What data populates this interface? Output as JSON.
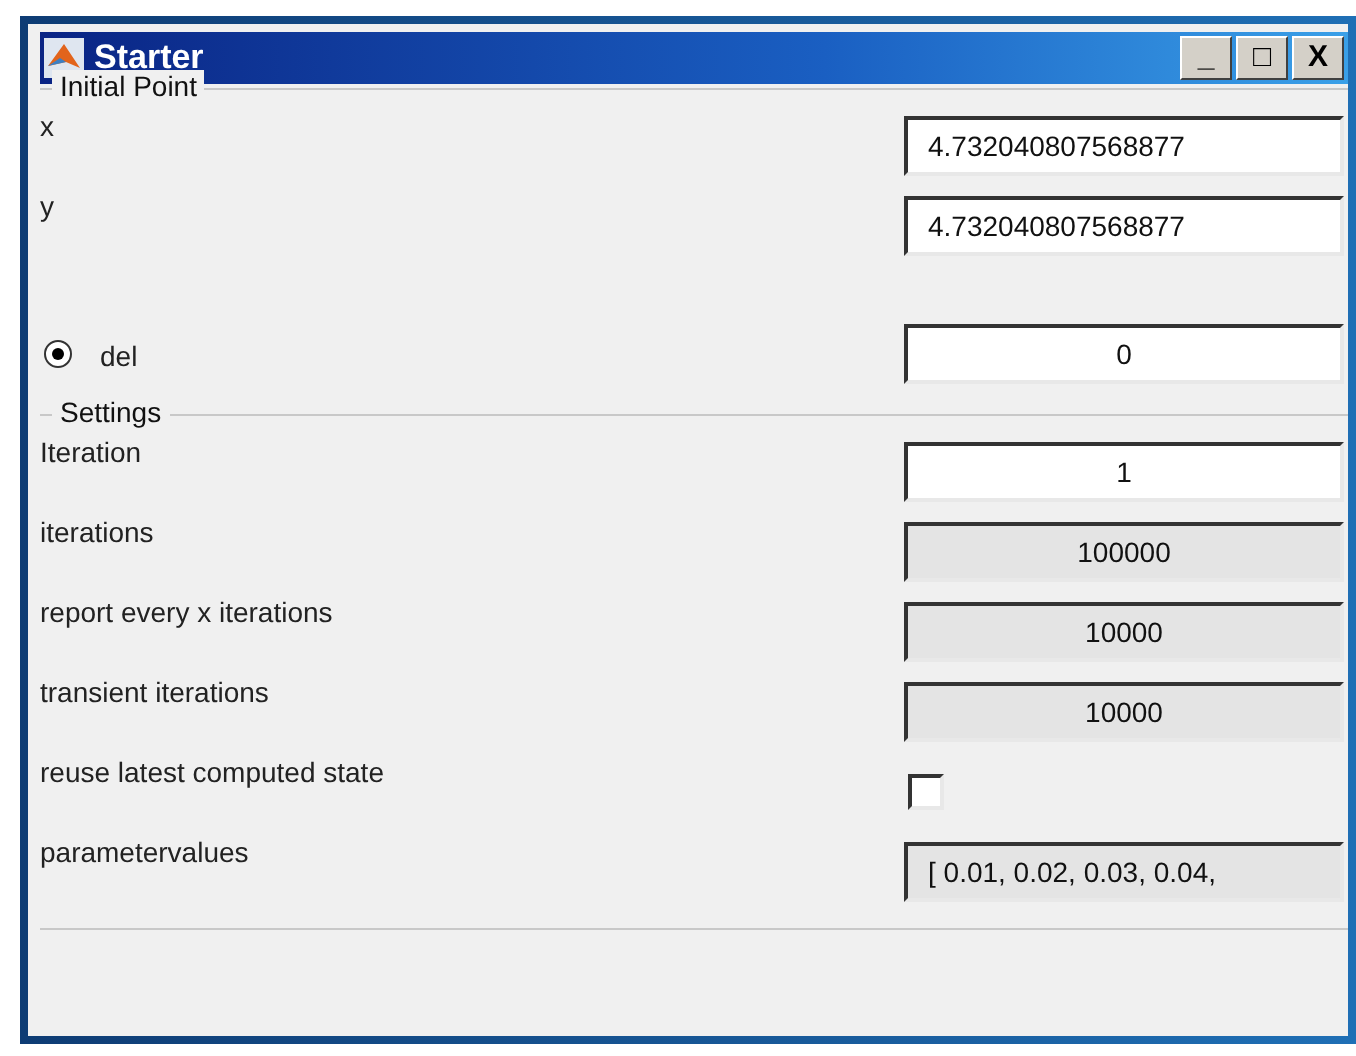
{
  "window": {
    "title": "Starter"
  },
  "title_buttons": [
    "_",
    "□",
    "X"
  ],
  "initial_point": {
    "title": "Initial Point",
    "rows": [
      {
        "kind": "text",
        "label": "x",
        "value": "4.732040807568877",
        "disabled": false
      },
      {
        "kind": "text",
        "label": "y",
        "value": "4.732040807568877",
        "disabled": false
      },
      {
        "kind": "radio",
        "label": "del",
        "selected": true,
        "value": "0",
        "disabled": false
      }
    ]
  },
  "settings": {
    "title": "Settings",
    "rows": [
      {
        "kind": "number",
        "label": "Iteration",
        "value": "1",
        "disabled": false
      },
      {
        "kind": "number",
        "label": "iterations",
        "value": "100000",
        "disabled": true
      },
      {
        "kind": "number",
        "label": "report every x iterations",
        "value": "10000",
        "disabled": true
      },
      {
        "kind": "number",
        "label": "transient iterations",
        "value": "10000",
        "disabled": true
      },
      {
        "kind": "checkbox",
        "label": "reuse latest computed state",
        "checked": false
      },
      {
        "kind": "text",
        "label": "parametervalues",
        "value": "[ 0.01, 0.02, 0.03, 0.04,",
        "disabled": true
      }
    ]
  }
}
